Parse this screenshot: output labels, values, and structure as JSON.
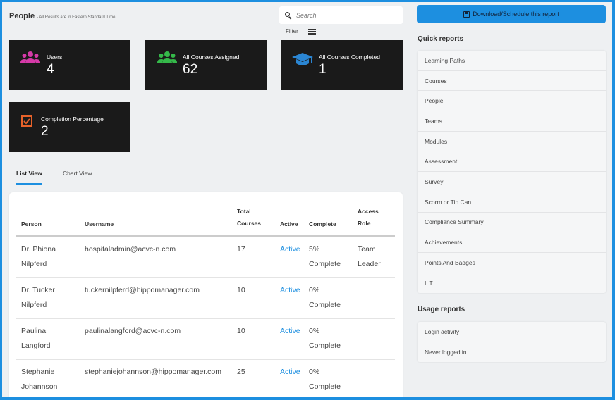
{
  "header": {
    "title": "People",
    "subtitle": "- All Results are in Eastern Standard Time"
  },
  "search": {
    "placeholder": "Search"
  },
  "filter": {
    "label": "Filter"
  },
  "download": {
    "label": "Download/Schedule this report"
  },
  "cards": [
    {
      "label": "Users",
      "value": "4"
    },
    {
      "label": "All Courses Assigned",
      "value": "62"
    },
    {
      "label": "All Courses Completed",
      "value": "1"
    },
    {
      "label": "Completion Percentage",
      "value": "2"
    }
  ],
  "colors": {
    "users_icon": "#d63aa8",
    "assigned_icon": "#35b94a",
    "completed_icon": "#2b86d3",
    "percentage_icon": "#e8622a",
    "accent": "#1d8fe0"
  },
  "tabs": [
    {
      "label": "List View",
      "active": true
    },
    {
      "label": "Chart View",
      "active": false
    }
  ],
  "table": {
    "headers": {
      "person": "Person",
      "username": "Username",
      "total_1": "Total",
      "total_2": "Courses",
      "active": "Active",
      "complete": "Complete",
      "access_1": "Access",
      "access_2": "Role"
    },
    "rows": [
      {
        "name_1": "Dr. Phiona",
        "name_2": "Nilpferd",
        "username": "hospitaladmin@acvc-n.com",
        "total": "17",
        "active": "Active",
        "complete_1": "5%",
        "complete_2": "Complete",
        "role_1": "Team",
        "role_2": "Leader"
      },
      {
        "name_1": "Dr. Tucker",
        "name_2": "Nilpferd",
        "username": "tuckernilpferd@hippomanager.com",
        "total": "10",
        "active": "Active",
        "complete_1": "0%",
        "complete_2": "Complete",
        "role_1": "",
        "role_2": ""
      },
      {
        "name_1": "Paulina",
        "name_2": "Langford",
        "username": "paulinalangford@acvc-n.com",
        "total": "10",
        "active": "Active",
        "complete_1": "0%",
        "complete_2": "Complete",
        "role_1": "",
        "role_2": ""
      },
      {
        "name_1": "Stephanie",
        "name_2": "Johannson",
        "username": "stephaniejohannson@hippomanager.com",
        "total": "25",
        "active": "Active",
        "complete_1": "0%",
        "complete_2": "Complete",
        "role_1": "",
        "role_2": ""
      }
    ]
  },
  "quick_reports": {
    "title": "Quick reports",
    "items": [
      "Learning Paths",
      "Courses",
      "People",
      "Teams",
      "Modules",
      "Assessment",
      "Survey",
      "Scorm or Tin Can",
      "Compliance Summary",
      "Achievements",
      "Points And Badges",
      "ILT"
    ]
  },
  "usage_reports": {
    "title": "Usage reports",
    "items": [
      "Login activity",
      "Never logged in"
    ]
  }
}
